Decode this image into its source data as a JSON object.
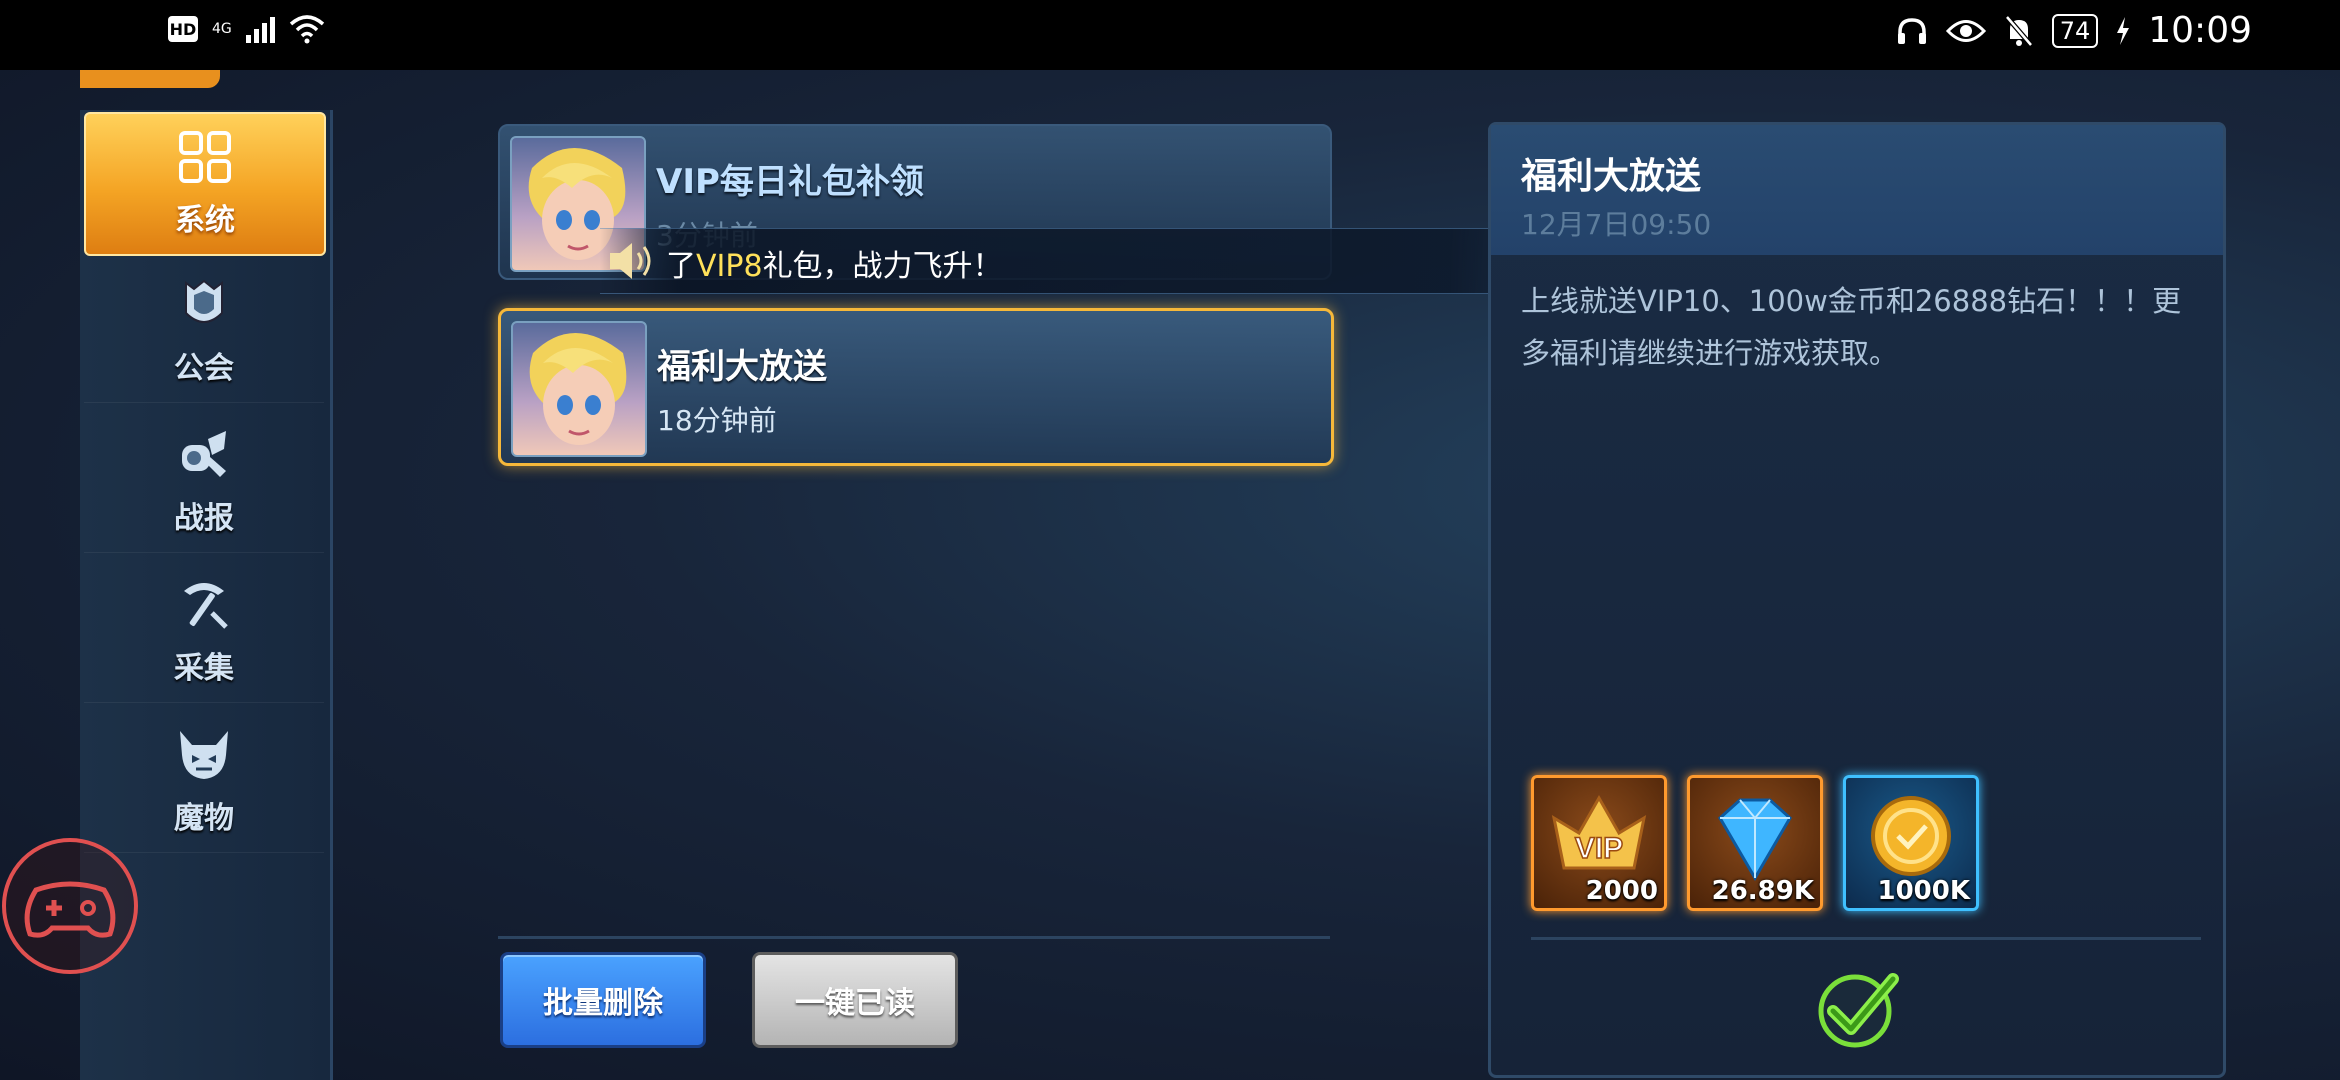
{
  "status_bar": {
    "network": "4G",
    "hd": "HD",
    "battery": "74",
    "time": "10:09"
  },
  "side_menu": {
    "items": [
      {
        "label": "系统",
        "icon": "grid-icon",
        "active": true
      },
      {
        "label": "公会",
        "icon": "guild-banner-icon",
        "active": false
      },
      {
        "label": "战报",
        "icon": "battle-report-icon",
        "active": false
      },
      {
        "label": "采集",
        "icon": "pickaxe-icon",
        "active": false
      },
      {
        "label": "魔物",
        "icon": "monster-icon",
        "active": false
      }
    ]
  },
  "mail_list": [
    {
      "title": "VIP每日礼包补领",
      "time": "3分钟前",
      "selected": false
    },
    {
      "title": "福利大放送",
      "time": "18分钟前",
      "selected": true
    }
  ],
  "broadcast": {
    "prefix": "了",
    "highlight": "VIP8",
    "suffix": "礼包，战力飞升！"
  },
  "buttons": {
    "batch_delete": "批量删除",
    "mark_all_read": "一键已读"
  },
  "detail": {
    "title": "福利大放送",
    "date": "12月7日09:50",
    "body": "上线就送VIP10、100w金币和26888钻石！！！更多福利请继续进行游戏获取。",
    "rewards": [
      {
        "icon": "vip-badge-icon",
        "count": "2000",
        "color": "#ff9a2e"
      },
      {
        "icon": "diamond-icon",
        "count": "26.89K",
        "color": "#ff9a2e"
      },
      {
        "icon": "gold-coin-icon",
        "count": "1000K",
        "color": "#3fc0ff"
      }
    ]
  }
}
